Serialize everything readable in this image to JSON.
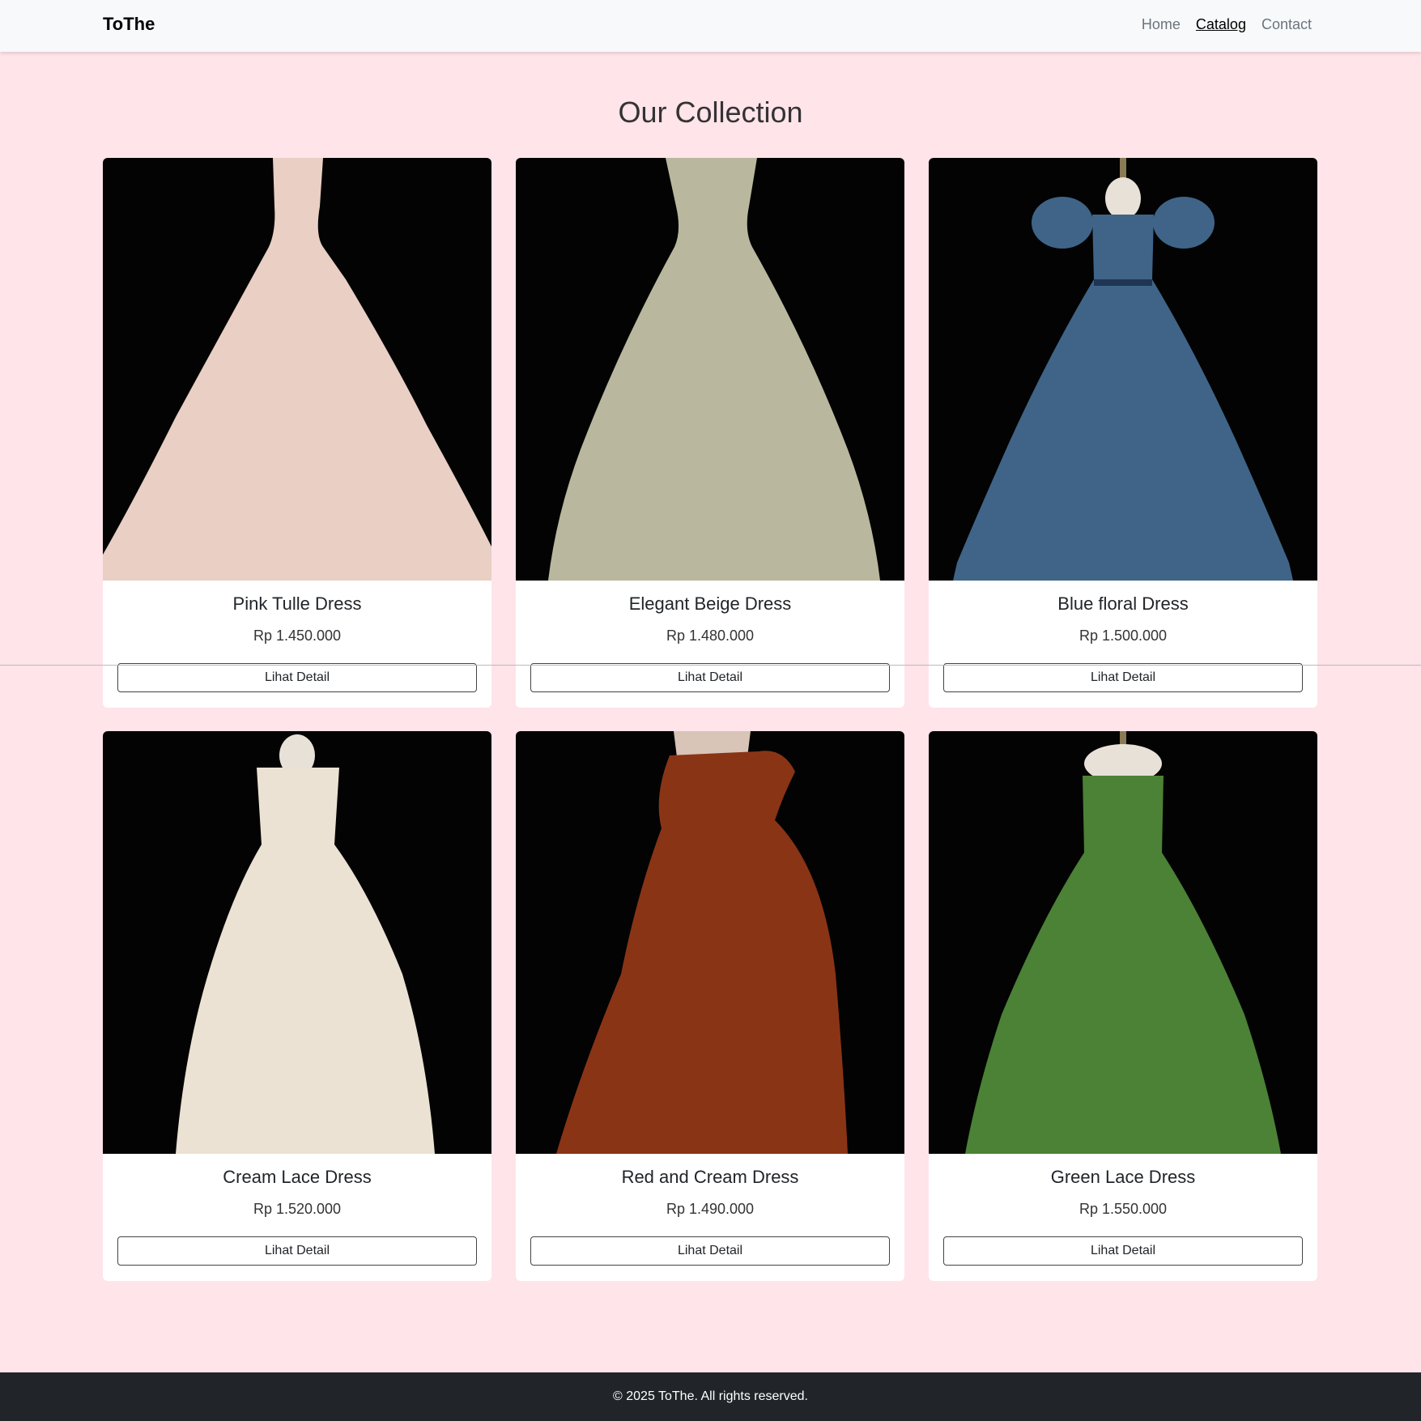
{
  "brand": "ToThe",
  "nav": {
    "home": "Home",
    "catalog": "Catalog",
    "contact": "Contact"
  },
  "page_title": "Our Collection",
  "products": [
    {
      "name": "Pink Tulle Dress",
      "price": "Rp 1.450.000",
      "button": "Lihat Detail",
      "color": "#e9cfc4"
    },
    {
      "name": "Elegant Beige Dress",
      "price": "Rp 1.480.000",
      "button": "Lihat Detail",
      "color": "#b9b89e"
    },
    {
      "name": "Blue floral Dress",
      "price": "Rp 1.500.000",
      "button": "Lihat Detail",
      "color": "#3f6488"
    },
    {
      "name": "Cream Lace Dress",
      "price": "Rp 1.520.000",
      "button": "Lihat Detail",
      "color": "#ebe2d4"
    },
    {
      "name": "Red and Cream Dress",
      "price": "Rp 1.490.000",
      "button": "Lihat Detail",
      "color": "#8a3416"
    },
    {
      "name": "Green Lace Dress",
      "price": "Rp 1.550.000",
      "button": "Lihat Detail",
      "color": "#4b8236"
    }
  ],
  "footer": "© 2025 ToThe. All rights reserved."
}
